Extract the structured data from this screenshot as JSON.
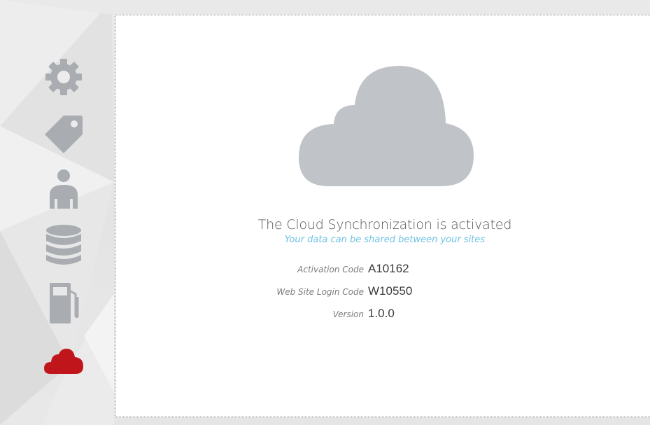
{
  "nav": {
    "items": [
      {
        "name": "settings",
        "icon": "gear-icon",
        "active": false
      },
      {
        "name": "tags",
        "icon": "tag-icon",
        "active": false
      },
      {
        "name": "users",
        "icon": "user-icon",
        "active": false
      },
      {
        "name": "database",
        "icon": "database-icon",
        "active": false
      },
      {
        "name": "fuel",
        "icon": "fuel-pump-icon",
        "active": false
      },
      {
        "name": "cloud",
        "icon": "cloud-icon",
        "active": true
      }
    ],
    "icon_color": "#a9adb1",
    "active_color": "#c0161b"
  },
  "main": {
    "hero_icon": "cloud-icon",
    "hero_color": "#c0c4c8",
    "status_title": "The Cloud Synchronization is activated",
    "status_subtitle": "Your data can be shared between your sites",
    "details": [
      {
        "label": "Activation Code",
        "value": "A10162"
      },
      {
        "label": "Web Site Login Code",
        "value": "W10550"
      },
      {
        "label": "Version",
        "value": "1.0.0"
      }
    ]
  }
}
